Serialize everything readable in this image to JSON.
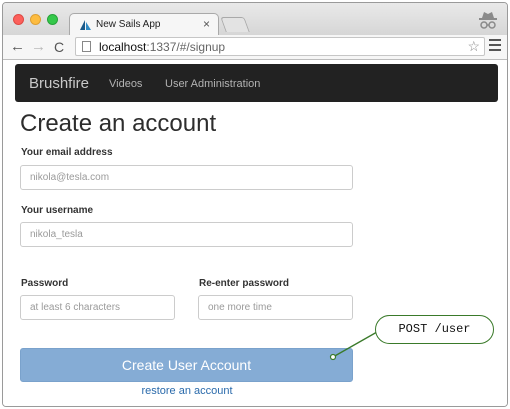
{
  "browser": {
    "tab_title": "New Sails App",
    "tab_close": "×",
    "url_host": "localhost",
    "url_path": ":1337/#/signup",
    "star": "☆"
  },
  "navbar": {
    "brand": "Brushfire",
    "links": [
      "Videos",
      "User Administration"
    ]
  },
  "page": {
    "title": "Create an account"
  },
  "form": {
    "email": {
      "label": "Your email address",
      "placeholder": "nikola@tesla.com"
    },
    "username": {
      "label": "Your username",
      "placeholder": "nikola_tesla"
    },
    "password": {
      "label": "Password",
      "placeholder": "at least 6 characters"
    },
    "confirm": {
      "label": "Re-enter password",
      "placeholder": "one more time"
    },
    "submit_label": "Create User Account",
    "restore_link": "restore an account"
  },
  "annotation": {
    "callout_text": "POST /user"
  },
  "colors": {
    "navbar_bg": "#222222",
    "submit_bg": "#85acd5",
    "link": "#2a6aab",
    "callout_border": "#3a7a2a"
  }
}
